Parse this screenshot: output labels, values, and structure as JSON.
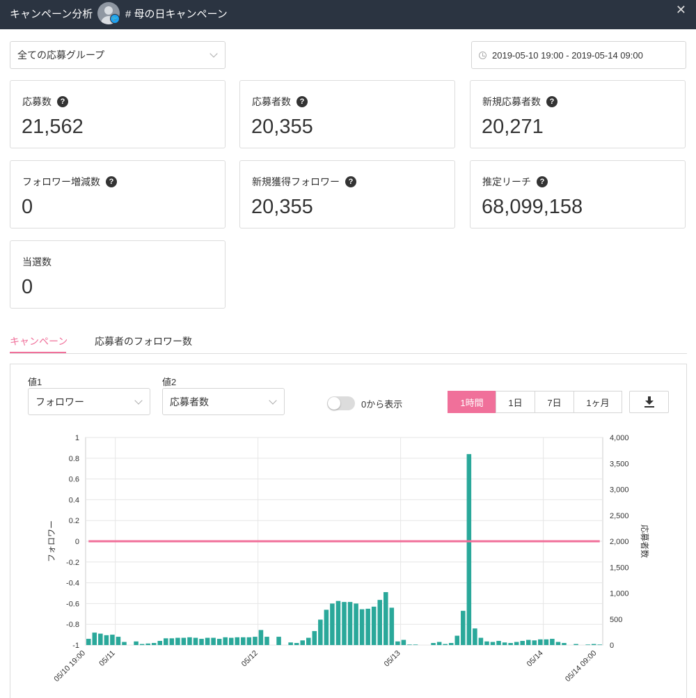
{
  "header": {
    "title": "キャンペーン分析",
    "campaign_name": "# 母の日キャンペーン",
    "close_icon": "close-icon",
    "badge_glyph": "🐦"
  },
  "filters": {
    "group_select": "全ての応募グループ",
    "date_range": "2019-05-10 19:00 - 2019-05-14 09:00"
  },
  "stats": [
    {
      "label": "応募数",
      "value": "21,562",
      "help": "?"
    },
    {
      "label": "応募者数",
      "value": "20,355",
      "help": "?"
    },
    {
      "label": "新規応募者数",
      "value": "20,271",
      "help": "?"
    },
    {
      "label": "フォロワー増減数",
      "value": "0",
      "help": "?"
    },
    {
      "label": "新規獲得フォロワー",
      "value": "20,355",
      "help": "?"
    },
    {
      "label": "推定リーチ",
      "value": "68,099,158",
      "help": "?"
    },
    {
      "label": "当選数",
      "value": "0"
    }
  ],
  "tabs": [
    {
      "label": "キャンペーン",
      "active": true
    },
    {
      "label": "応募者のフォロワー数",
      "active": false
    }
  ],
  "controls": {
    "value1_label": "値1",
    "value1_select": "フォロワー",
    "value2_label": "値2",
    "value2_select": "応募者数",
    "toggle_label": "0から表示",
    "toggle_on": false,
    "periods": [
      "1時間",
      "1日",
      "7日",
      "1ヶ月"
    ],
    "active_period": "1時間"
  },
  "colors": {
    "accent": "#f0709a",
    "bar": "#2aa89a",
    "header_bg": "#2b3441"
  },
  "chart_data": {
    "type": "bar",
    "left_axis": {
      "label": "フォロワー",
      "ticks": [
        "1",
        "0.8",
        "0.6",
        "0.4",
        "0.2",
        "0",
        "-0.2",
        "-0.4",
        "-0.6",
        "-0.8",
        "-1"
      ],
      "ylim": [
        -1,
        1
      ]
    },
    "right_axis": {
      "label": "応募者数",
      "ticks": [
        "4,000",
        "3,500",
        "3,000",
        "2,500",
        "2,000",
        "1,500",
        "1,000",
        "500",
        "0"
      ],
      "ylim": [
        0,
        4000
      ]
    },
    "x_ticks": [
      "05/10 19:00",
      "05/11",
      "05/12",
      "05/13",
      "05/14",
      "05/14 09:00"
    ],
    "x_tick_hours": [
      0,
      5,
      29,
      53,
      77,
      86
    ],
    "series": [
      {
        "name": "フォロワー",
        "type": "line",
        "axis": "left",
        "values": [
          0,
          0,
          0,
          0,
          0,
          0,
          0,
          0,
          0,
          0,
          0,
          0,
          0,
          0,
          0,
          0,
          0,
          0,
          0,
          0,
          0,
          0,
          0,
          0,
          0,
          0,
          0,
          0,
          0,
          0,
          0,
          0,
          0,
          0,
          0,
          0,
          0,
          0,
          0,
          0,
          0,
          0,
          0,
          0,
          0,
          0,
          0,
          0,
          0,
          0,
          0,
          0,
          0,
          0,
          0,
          0,
          0,
          0,
          0,
          0,
          0,
          0,
          0,
          0,
          0,
          0,
          0,
          0,
          0,
          0,
          0,
          0,
          0,
          0,
          0,
          0,
          0,
          0,
          0,
          0,
          0,
          0,
          0,
          0,
          0,
          0,
          0
        ]
      },
      {
        "name": "応募者数",
        "type": "bar",
        "axis": "right",
        "values": [
          120,
          240,
          220,
          190,
          200,
          160,
          60,
          0,
          70,
          20,
          30,
          40,
          80,
          130,
          130,
          140,
          140,
          150,
          140,
          120,
          140,
          140,
          120,
          150,
          140,
          150,
          150,
          150,
          160,
          290,
          160,
          0,
          160,
          0,
          50,
          40,
          90,
          140,
          270,
          490,
          680,
          800,
          850,
          830,
          830,
          800,
          690,
          700,
          740,
          870,
          1020,
          720,
          70,
          100,
          10,
          10,
          0,
          0,
          40,
          60,
          20,
          40,
          180,
          660,
          3680,
          320,
          140,
          70,
          60,
          80,
          50,
          40,
          60,
          80,
          100,
          90,
          110,
          110,
          120,
          60,
          40,
          0,
          20,
          0,
          10,
          20,
          10
        ]
      }
    ]
  }
}
